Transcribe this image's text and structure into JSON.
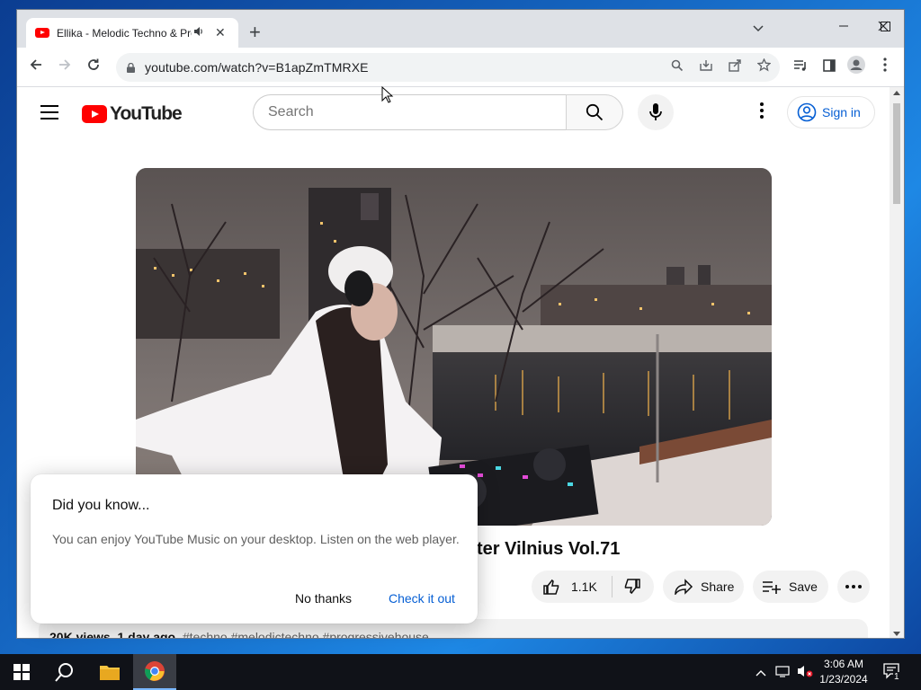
{
  "browser": {
    "tab_title": "Ellika - Melodic Techno & Progressive House",
    "new_tab_symbol": "+",
    "url": "youtube.com/watch?v=B1apZmTMRXE"
  },
  "youtube": {
    "logo_text": "YouTube",
    "search_placeholder": "Search",
    "sign_in_label": "Sign in",
    "video": {
      "title_visible": "ter Vilnius Vol.71",
      "likes": "1.1K",
      "share_label": "Share",
      "save_label": "Save",
      "views": "20K views",
      "age": "1 day ago",
      "hashtags": "#techno #melodictechno #progressivehouse"
    }
  },
  "dialog": {
    "title": "Did you know...",
    "body": "You can enjoy YouTube Music on your desktop. Listen on the web player.",
    "dismiss_label": "No thanks",
    "confirm_label": "Check it out"
  },
  "taskbar": {
    "time": "3:06 AM",
    "date": "1/23/2024",
    "notification_count": "1"
  },
  "colors": {
    "accent_blue": "#065fd4",
    "youtube_red": "#ff0000",
    "taskbar": "#101218"
  }
}
